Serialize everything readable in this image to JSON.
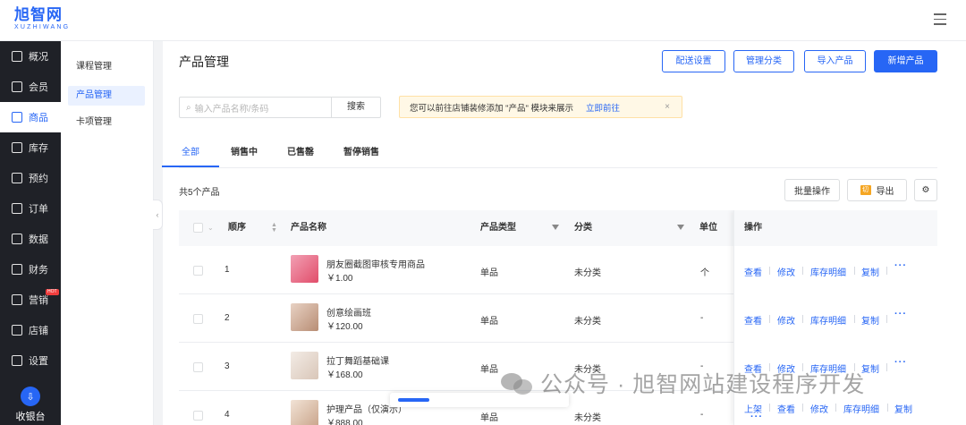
{
  "brand": {
    "name": "旭智网",
    "sub": "XUZHIWANG"
  },
  "sidebar": {
    "items": [
      {
        "label": "概况",
        "icon": "overview-icon"
      },
      {
        "label": "会员",
        "icon": "crown-icon"
      },
      {
        "label": "商品",
        "icon": "store-icon",
        "active": true
      },
      {
        "label": "库存",
        "icon": "inventory-icon"
      },
      {
        "label": "预约",
        "icon": "calendar-check-icon"
      },
      {
        "label": "订单",
        "icon": "order-icon"
      },
      {
        "label": "数据",
        "icon": "chart-icon"
      },
      {
        "label": "财务",
        "icon": "finance-icon"
      },
      {
        "label": "营销",
        "icon": "marketing-icon",
        "badge": "HOT"
      },
      {
        "label": "店铺",
        "icon": "shop-icon"
      },
      {
        "label": "设置",
        "icon": "settings-icon"
      }
    ],
    "cashier": "收银台"
  },
  "subnav": {
    "items": [
      "课程管理",
      "产品管理",
      "卡项管理"
    ]
  },
  "page": {
    "title": "产品管理",
    "buttons": {
      "delivery": "配送设置",
      "category": "管理分类",
      "import": "导入产品",
      "add": "新增产品"
    }
  },
  "search": {
    "placeholder": "输入产品名称/条码",
    "button": "搜索"
  },
  "notice": {
    "text": "您可以前往店铺装修添加 \"产品\" 模块来展示",
    "link": "立即前往",
    "close": "×"
  },
  "tabs": [
    "全部",
    "销售中",
    "已售罄",
    "暂停销售"
  ],
  "list": {
    "count": "共5个产品",
    "batch": "批量操作",
    "export": "导出",
    "export_icon_text": "切"
  },
  "table": {
    "headers": {
      "seq": "顺序",
      "name": "产品名称",
      "type": "产品类型",
      "category": "分类",
      "unit": "单位",
      "ops": "操作"
    },
    "rows": [
      {
        "seq": "1",
        "name": "朋友圈截图审核专用商品",
        "price": "￥1.00",
        "type": "单品",
        "category": "未分类",
        "unit": "个",
        "ops": [
          "查看",
          "修改",
          "库存明细",
          "复制"
        ]
      },
      {
        "seq": "2",
        "name": "创意绘画班",
        "price": "￥120.00",
        "type": "单品",
        "category": "未分类",
        "unit": "-",
        "ops": [
          "查看",
          "修改",
          "库存明细",
          "复制"
        ]
      },
      {
        "seq": "3",
        "name": "拉丁舞蹈基础课",
        "price": "￥168.00",
        "type": "单品",
        "category": "未分类",
        "unit": "-",
        "ops": [
          "查看",
          "修改",
          "库存明细",
          "复制"
        ]
      },
      {
        "seq": "4",
        "name": "护理产品（仅演示）",
        "price": "￥888.00",
        "type": "单品",
        "category": "未分类",
        "unit": "-",
        "ops": [
          "上架",
          "查看",
          "修改",
          "库存明细",
          "复制"
        ]
      }
    ],
    "more": "···"
  },
  "watermark": "公众号 · 旭智网站建设程序开发",
  "colors": {
    "primary": "#2766f5",
    "sidebar_bg": "#1f2127",
    "notice_bg": "#fff8e6"
  }
}
